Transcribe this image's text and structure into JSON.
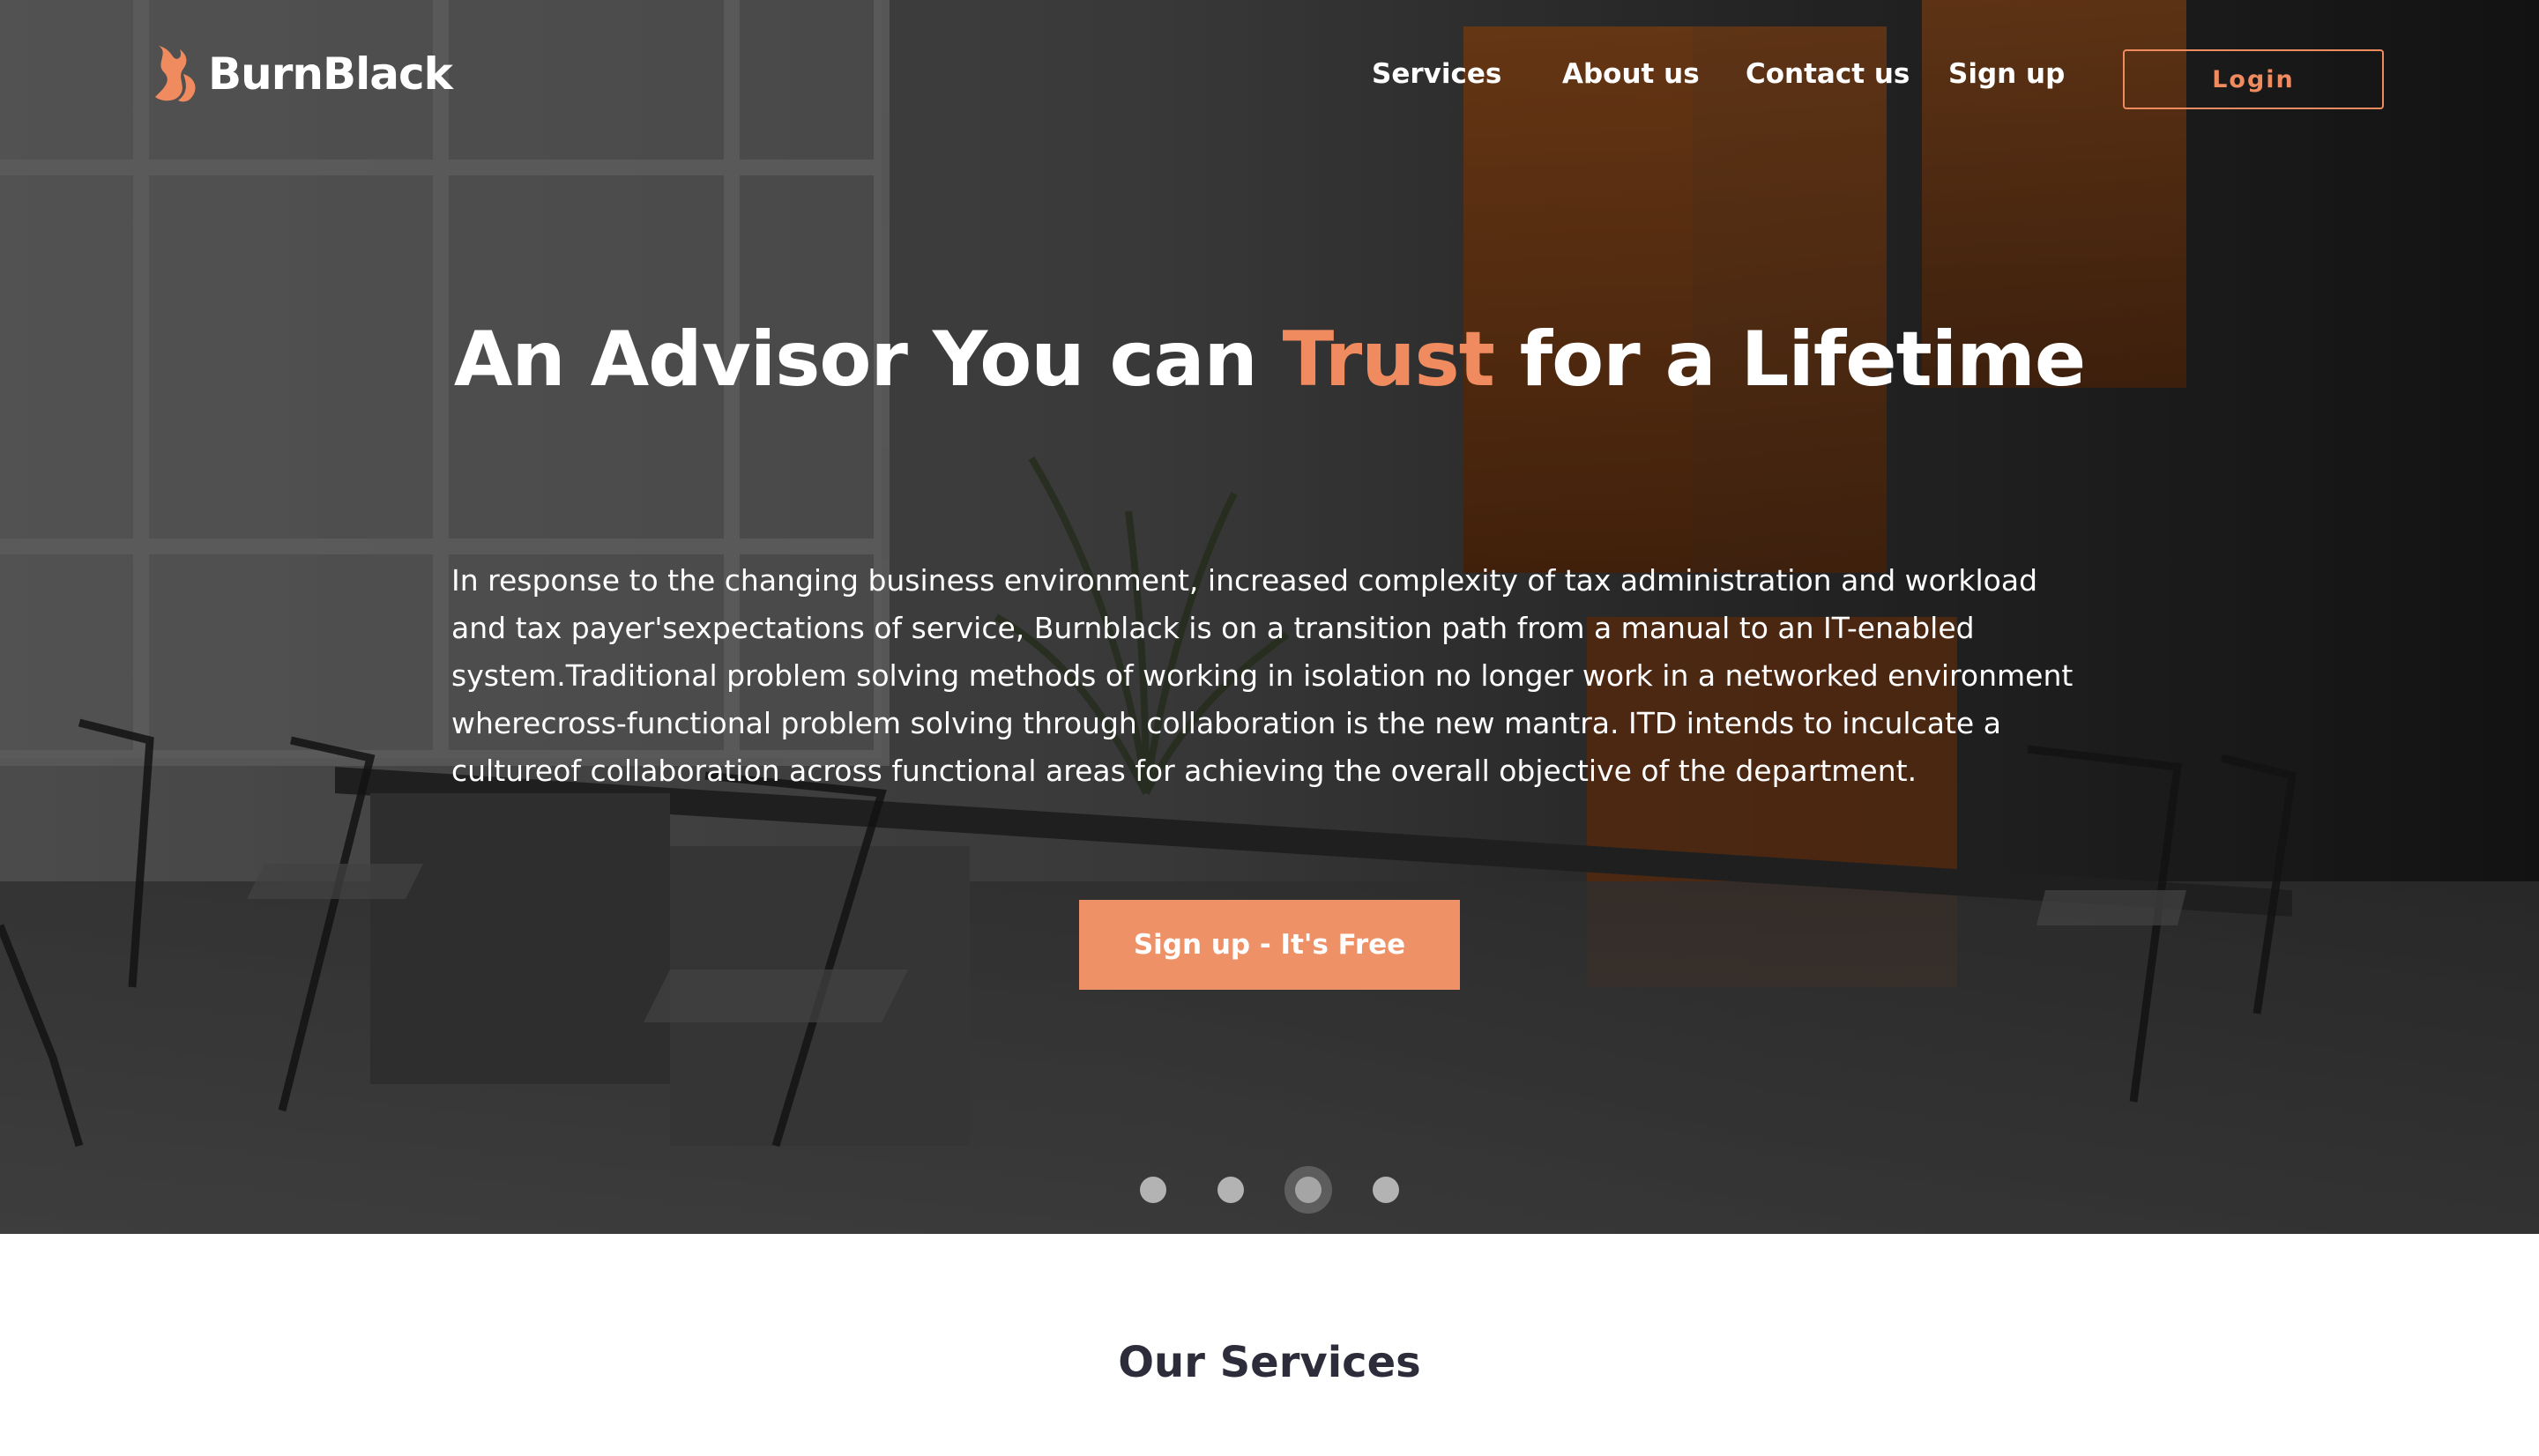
{
  "brand": {
    "name": "BurnBlack",
    "accent_color": "#ef8b5e",
    "logo_icon": "flame-logo-icon"
  },
  "nav": {
    "links": [
      "Services",
      "About us",
      "Contact us",
      "Sign up"
    ],
    "login_label": "Login"
  },
  "hero": {
    "headline_before": "An Advisor You can ",
    "headline_accent": "Trust",
    "headline_after": " for a Lifetime",
    "description": "In response to the changing business environment, increased complexity of tax administration and workload and tax payer'sexpectations of service, Burnblack is on a transition path from a manual to an IT-enabled system.Traditional problem solving methods of working in isolation no longer work in a networked environment wherecross-functional problem solving through collaboration is the new mantra. ITD intends to inculcate a cultureof collaboration across functional areas for achieving the overall objective of the department.",
    "cta_label": "Sign up - It's Free",
    "cta_color": "#ef9167",
    "carousel": {
      "slide_count": 4,
      "active_index": 2
    }
  },
  "services": {
    "title": "Our Services"
  }
}
